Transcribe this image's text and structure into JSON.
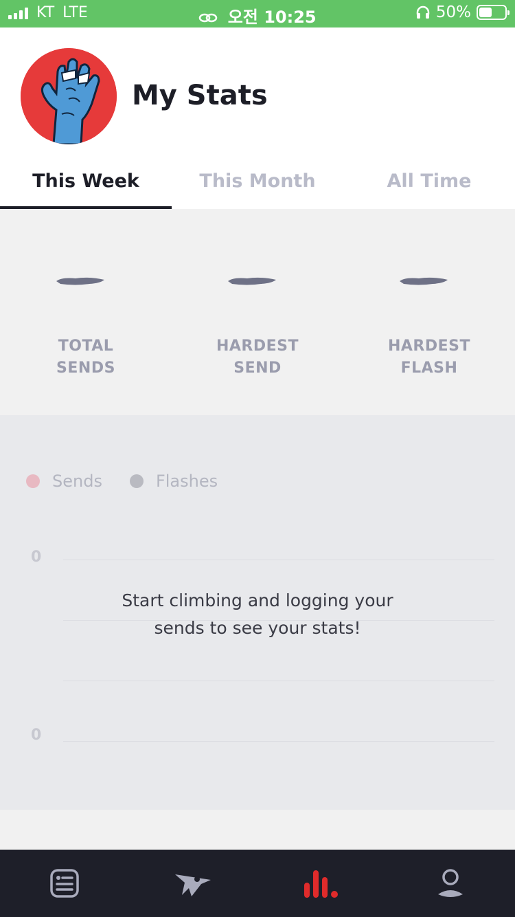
{
  "status_bar": {
    "carrier": "KT",
    "network": "LTE",
    "time": "오전 10:25",
    "battery": "50%",
    "background_color": "#62c466"
  },
  "header": {
    "title": "My Stats",
    "avatar_icon": "zombie-hand-avatar"
  },
  "tabs": [
    {
      "label": "This Week",
      "active": true
    },
    {
      "label": "This Month",
      "active": false
    },
    {
      "label": "All Time",
      "active": false
    }
  ],
  "summary": {
    "stats": [
      {
        "label_line1": "TOTAL",
        "label_line2": "SENDS"
      },
      {
        "label_line1": "HARDEST",
        "label_line2": "SEND"
      },
      {
        "label_line1": "HARDEST",
        "label_line2": "FLASH"
      }
    ]
  },
  "chart": {
    "legend": [
      {
        "label": "Sends",
        "color": "#e8b9c2"
      },
      {
        "label": "Flashes",
        "color": "#b9bac1"
      }
    ],
    "y_axis_top": "0",
    "y_axis_bottom": "0",
    "empty_message_line1": "Start climbing and logging your",
    "empty_message_line2": "sends to see your stats!"
  },
  "chart_data": {
    "type": "bar",
    "series": [
      {
        "name": "Sends",
        "values": []
      },
      {
        "name": "Flashes",
        "values": []
      }
    ],
    "y_tick_labels": [
      "0",
      "0"
    ],
    "grid": true,
    "legend_position": "top-left"
  },
  "bottom_nav": [
    {
      "icon": "list-icon",
      "active": false
    },
    {
      "icon": "climber-icon",
      "active": false
    },
    {
      "icon": "stats-icon",
      "active": true,
      "color": "#e02b2b"
    },
    {
      "icon": "profile-icon",
      "active": false
    }
  ]
}
